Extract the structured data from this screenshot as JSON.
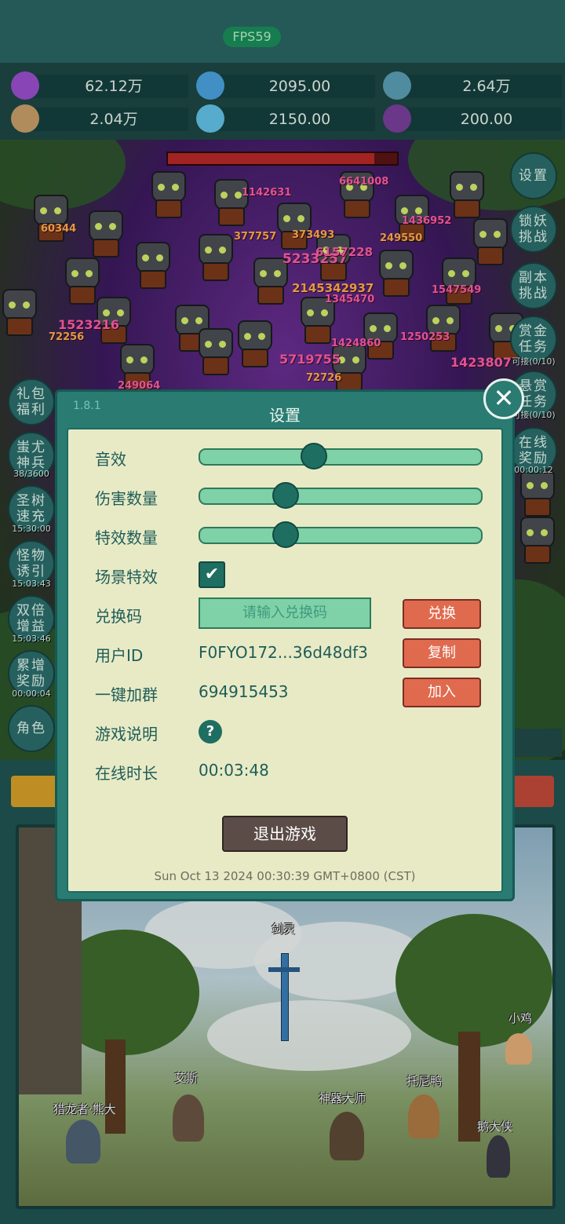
{
  "fps": "FPS59",
  "resources": [
    {
      "value": "62.12万",
      "icon": "purple-gem-icon",
      "color": "#9a4fd0"
    },
    {
      "value": "2095.00",
      "icon": "blue-orb-icon",
      "color": "#4aa3e0"
    },
    {
      "value": "2.64万",
      "icon": "earth-orb-icon",
      "color": "#5aa0b5"
    },
    {
      "value": "2.04万",
      "icon": "scroll-icon",
      "color": "#c9a06a"
    },
    {
      "value": "2150.00",
      "icon": "ice-crystal-icon",
      "color": "#63c3ea"
    },
    {
      "value": "200.00",
      "icon": "purple-pot-icon",
      "color": "#7a3f9c"
    }
  ],
  "right_menu": [
    {
      "label": "设置",
      "sub": ""
    },
    {
      "label": "锁妖挑战",
      "sub": ""
    },
    {
      "label": "副本挑战",
      "sub": ""
    },
    {
      "label": "赏金任务",
      "sub": "可接(0/10)"
    },
    {
      "label": "悬赏任务",
      "sub": "可接(0/10)"
    },
    {
      "label": "在线奖励",
      "sub": "00:00:12"
    }
  ],
  "left_menu": [
    {
      "label": "礼包福利",
      "sub": ""
    },
    {
      "label": "蚩尤神兵",
      "sub": "38/3600"
    },
    {
      "label": "圣树速充",
      "sub": "15:30:00"
    },
    {
      "label": "怪物诱引",
      "sub": "15:03:43"
    },
    {
      "label": "双倍增益",
      "sub": "15:03:46"
    },
    {
      "label": "累增奖励",
      "sub": "00:00:04"
    },
    {
      "label": "角色",
      "sub": ""
    }
  ],
  "damage_numbers": [
    "1142631",
    "6641008",
    "60344",
    "377757",
    "373493",
    "1436952",
    "249550",
    "5233257",
    "6157228",
    "2145342937",
    "1345470",
    "1523216",
    "72256",
    "1547549",
    "1424860",
    "1250253",
    "5719755",
    "1423807",
    "249064",
    "72726"
  ],
  "dialog": {
    "version": "1.8.1",
    "title": "设置",
    "sound_label": "音效",
    "sound_level": 0.4,
    "damage_count_label": "伤害数量",
    "damage_count_level": 0.3,
    "effect_count_label": "特效数量",
    "effect_count_level": 0.3,
    "scene_effect_label": "场景特效",
    "scene_effect_checked": true,
    "redeem_label": "兑换码",
    "redeem_placeholder": "请输入兑换码",
    "redeem_button": "兑换",
    "userid_label": "用户ID",
    "userid_value": "F0FYO172...36d48df3",
    "copy_button": "复制",
    "group_label": "一键加群",
    "group_value": "694915453",
    "join_button": "加入",
    "help_label": "游戏说明",
    "help_icon": "?",
    "online_label": "在线时长",
    "online_value": "00:03:48",
    "quit_button": "退出游戏",
    "datetime": "Sun Oct 13 2024 00:30:39 GMT+0800 (CST)"
  },
  "scene_names": [
    "剑灵",
    "小鸡",
    "艾斯",
    "托尼鸭",
    "神器大师",
    "猎龙者·熊大",
    "鹅大侠"
  ]
}
